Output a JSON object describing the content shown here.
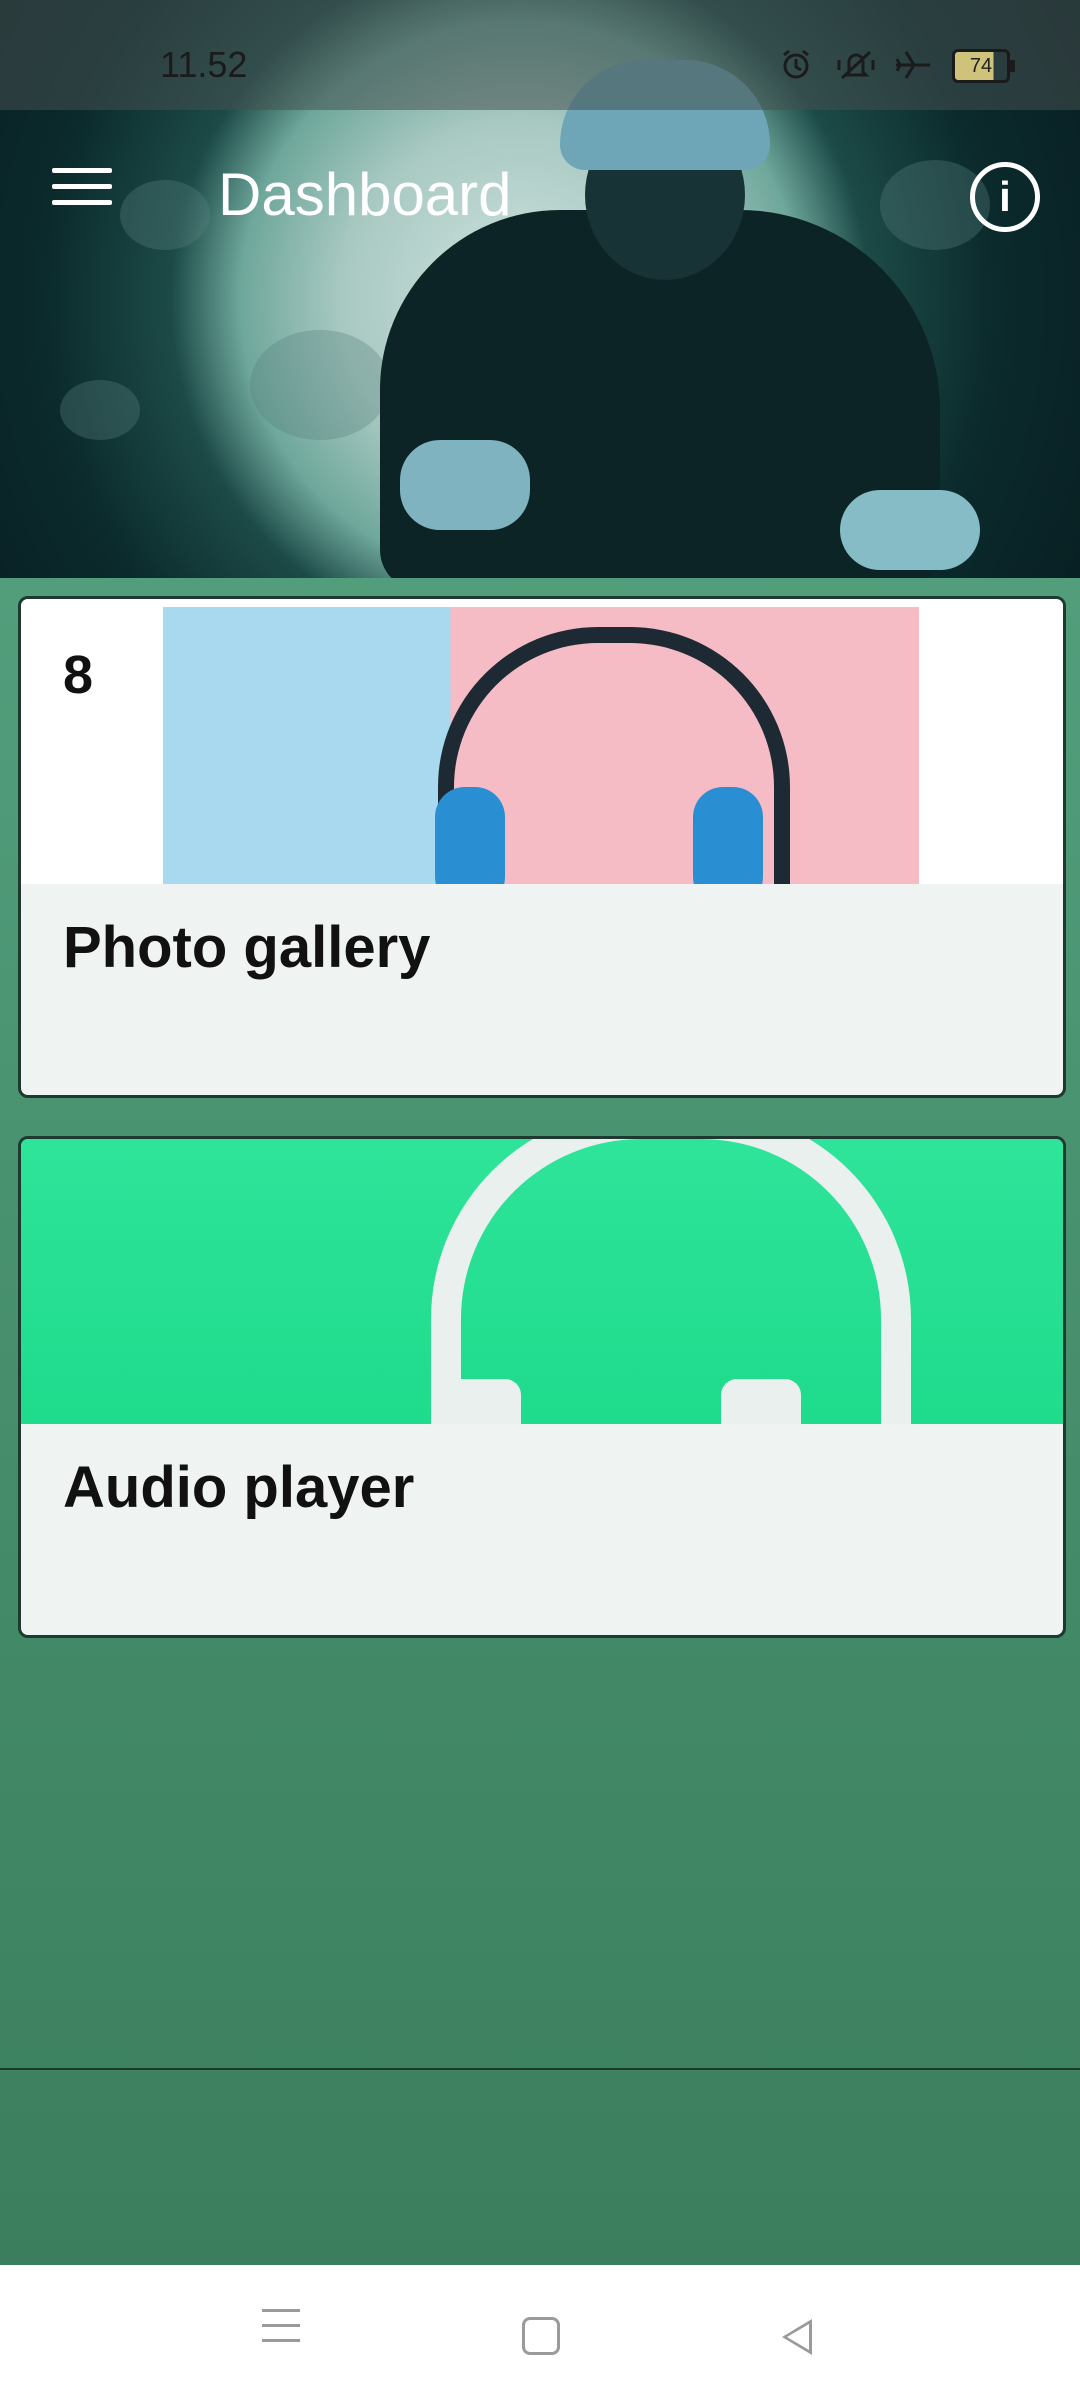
{
  "status_bar": {
    "time": "11.52",
    "battery_level": "74",
    "icons": [
      "alarm-icon",
      "vibrate-off-icon",
      "airplane-mode-icon",
      "battery-icon"
    ]
  },
  "app_bar": {
    "title": "Dashboard",
    "menu_icon": "hamburger-menu-icon",
    "info_icon": "info-icon"
  },
  "cards": [
    {
      "title": "Photo gallery",
      "count": "8",
      "image": "blue-headphones-on-blue-pink-background"
    },
    {
      "title": "Audio player",
      "image": "white-headphones-on-green-background"
    }
  ],
  "nav_bar": {
    "icons": [
      "recents-icon",
      "home-icon",
      "back-icon"
    ]
  }
}
